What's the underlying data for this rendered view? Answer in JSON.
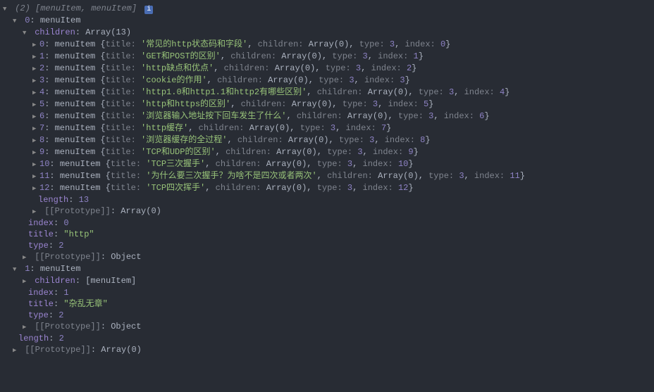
{
  "header": {
    "count": "(2)",
    "summary": "[menuItem, menuItem]",
    "info_glyph": "i"
  },
  "item0": {
    "idx": "0",
    "cls": "menuItem",
    "children_label": "children",
    "children_type": "Array(13)",
    "rows": [
      {
        "idx": "0",
        "title": "常见的http状态码和字段",
        "children": "Array(0)",
        "type": "3",
        "index": "0"
      },
      {
        "idx": "1",
        "title": "GET和POST的区别",
        "children": "Array(0)",
        "type": "3",
        "index": "1"
      },
      {
        "idx": "2",
        "title": "http缺点和优点",
        "children": "Array(0)",
        "type": "3",
        "index": "2"
      },
      {
        "idx": "3",
        "title": "cookie的作用",
        "children": "Array(0)",
        "type": "3",
        "index": "3"
      },
      {
        "idx": "4",
        "title": "http1.0和http1.1和http2有哪些区别",
        "children": "Array(0)",
        "type": "3",
        "index": "4"
      },
      {
        "idx": "5",
        "title": "http和https的区别",
        "children": "Array(0)",
        "type": "3",
        "index": "5"
      },
      {
        "idx": "6",
        "title": "浏览器输入地址按下回车发生了什么",
        "children": "Array(0)",
        "type": "3",
        "index": "6"
      },
      {
        "idx": "7",
        "title": "http缓存",
        "children": "Array(0)",
        "type": "3",
        "index": "7"
      },
      {
        "idx": "8",
        "title": "浏览器缓存的全过程",
        "children": "Array(0)",
        "type": "3",
        "index": "8"
      },
      {
        "idx": "9",
        "title": "TCP和UDP的区别",
        "children": "Array(0)",
        "type": "3",
        "index": "9"
      },
      {
        "idx": "10",
        "title": "TCP三次握手",
        "children": "Array(0)",
        "type": "3",
        "index": "10"
      },
      {
        "idx": "11",
        "title": "为什么要三次握手？为啥不是四次或者两次",
        "children": "Array(0)",
        "type": "3",
        "index": "11"
      },
      {
        "idx": "12",
        "title": "TCP四次挥手",
        "children": "Array(0)",
        "type": "3",
        "index": "12"
      }
    ],
    "length_label": "length",
    "length_value": "13",
    "proto_label": "[[Prototype]]",
    "proto_value": "Array(0)",
    "index_label": "index",
    "index_value": "0",
    "title_label": "title",
    "title_value": "\"http\"",
    "type_label": "type",
    "type_value": "2",
    "objproto_value": "Object"
  },
  "item1": {
    "idx": "1",
    "cls": "menuItem",
    "children_label": "children",
    "children_summary": "[menuItem]",
    "index_label": "index",
    "index_value": "1",
    "title_label": "title",
    "title_value": "\"杂乱无章\"",
    "type_label": "type",
    "type_value": "2",
    "proto_label": "[[Prototype]]",
    "proto_value": "Object"
  },
  "footer": {
    "length_label": "length",
    "length_value": "2",
    "proto_label": "[[Prototype]]",
    "proto_value": "Array(0)"
  },
  "labels": {
    "cls": "menuItem",
    "title": "title",
    "children": "children",
    "type": "type",
    "index": "index"
  }
}
